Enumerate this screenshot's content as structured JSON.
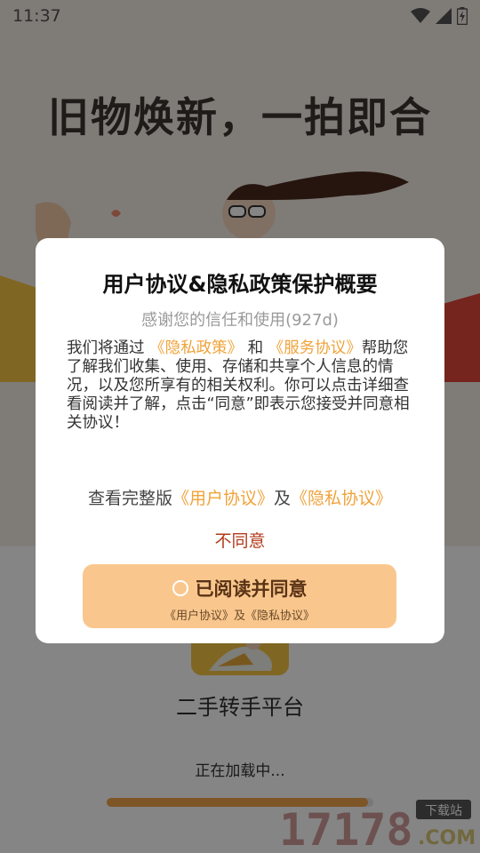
{
  "status_bar": {
    "time": "11:37"
  },
  "splash": {
    "headline": "旧物焕新，一拍即合",
    "app_name": "二手转手平台",
    "loading_text": "正在加载中...",
    "progress": 0.98
  },
  "dialog": {
    "title": "用户协议&隐私政策保护概要",
    "subtitle": "感谢您的信任和使用(927d)",
    "body_prefix": "我们将通过",
    "privacy_link": "《隐私政策》",
    "and_word": "和",
    "service_link": "《服务协议》",
    "body_rest": "帮助您了解我们收集、使用、存储和共享个人信息的情况，以及您所享有的相关权利。你可以点击详细查看阅读并了解，点击“同意”即表示您接受并同意相关协议！",
    "full_version_prefix": "查看完整版",
    "user_agreement_link": "《用户协议》",
    "full_and": "及",
    "privacy_agreement_link": "《隐私协议》",
    "disagree_label": "不同意",
    "agree_label": "已阅读并同意",
    "agree_sublabel": "《用户协议》及《隐私协议》"
  },
  "watermark": {
    "brand": "17178",
    "tag": "下载站",
    "domain": ".COM"
  },
  "colors": {
    "accent": "#f0a33a",
    "agree_button": "#f9c78d",
    "disagree": "#b23a19"
  }
}
